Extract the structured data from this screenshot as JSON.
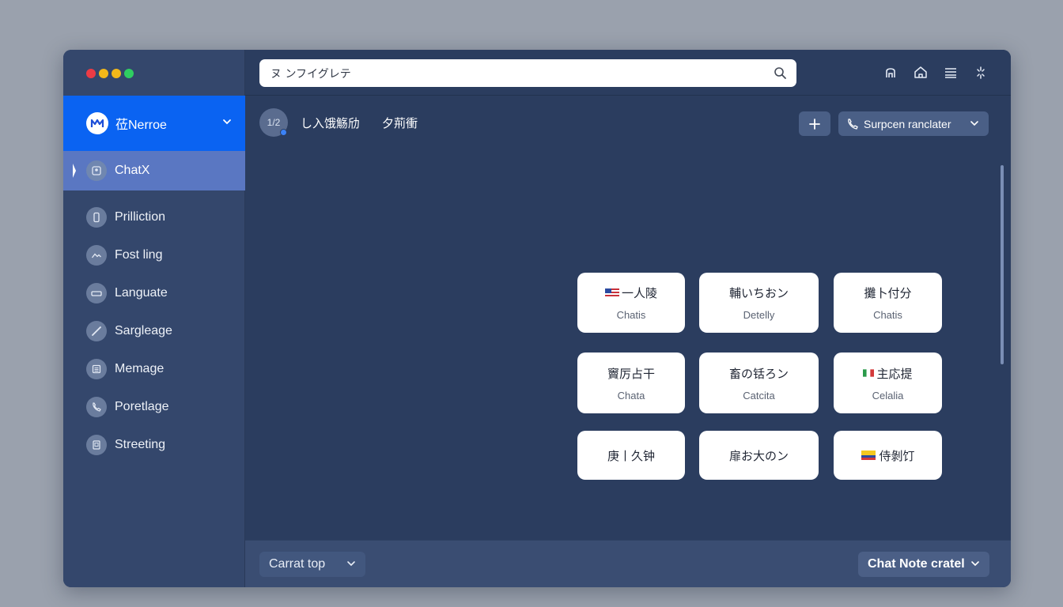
{
  "colors": {
    "window_bg": "#2b3d5f",
    "sidebar_bg": "#34476c",
    "workspace_bg": "#0a63f2",
    "active_item_bg": "#5a77c2",
    "traffic": [
      "#ec3b45",
      "#f2b81a",
      "#f2b81a",
      "#2fce61"
    ]
  },
  "search": {
    "value": "ヌ ンフイグレテ",
    "icon": "search-icon"
  },
  "top_icons": [
    "person-icon",
    "home-icon",
    "list-icon",
    "settings-icon"
  ],
  "workspace": {
    "name": "莅Nerroe",
    "logo": "logo-icon"
  },
  "sidebar": {
    "active": {
      "label": "ChatX",
      "icon": "contact-icon"
    },
    "items": [
      {
        "label": "Prillicti͏on",
        "icon": "phone-device-icon"
      },
      {
        "label": "Fost ling",
        "icon": "image-icon"
      },
      {
        "label": "Languate",
        "icon": "keyboard-icon"
      },
      {
        "label": "Sargleage",
        "icon": "pen-icon"
      },
      {
        "label": "Memage",
        "icon": "calendar-icon"
      },
      {
        "label": "Poretlage",
        "icon": "phone-icon"
      },
      {
        "label": "Streeting",
        "icon": "document-icon"
      }
    ]
  },
  "conversation": {
    "avatar": "1/2",
    "name": "し入饿觞劤",
    "status": "夕荊衝",
    "call_dropdown": "Surpcen ranclater"
  },
  "cards": [
    {
      "title": "一人陵",
      "subtitle": "Chatis",
      "flag": "us"
    },
    {
      "title": "輔いちおン",
      "subtitle": "Detelly",
      "flag": ""
    },
    {
      "title": "攤卜付分",
      "subtitle": "Chatis",
      "flag": ""
    },
    {
      "title": "竇厉占干",
      "subtitle": "Chata",
      "flag": ""
    },
    {
      "title": "畜の铦ろン",
      "subtitle": "Catcita",
      "flag": ""
    },
    {
      "title": "主応提",
      "subtitle": "Celalia",
      "flag": "it"
    },
    {
      "title": "庚丨久钟",
      "subtitle": "",
      "flag": ""
    },
    {
      "title": "扉お大のン",
      "subtitle": "",
      "flag": ""
    },
    {
      "title": "侍剝饤",
      "subtitle": "",
      "flag": "co"
    }
  ],
  "bottom": {
    "left_dropdown": "Carrat top",
    "right_dropdown": "Chat Note cratel"
  }
}
